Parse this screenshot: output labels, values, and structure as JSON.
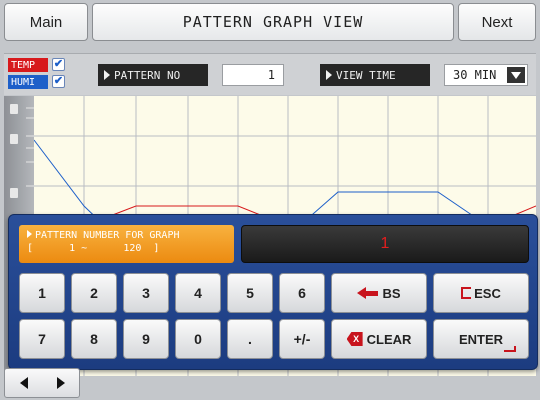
{
  "header": {
    "left_button": "Main",
    "title": "PATTERN GRAPH VIEW",
    "right_button": "Next"
  },
  "controls": {
    "temp_label": "TEMP",
    "humi_label": "HUMI",
    "temp_checked": true,
    "humi_checked": true,
    "pattern_no_label": "PATTERN NO",
    "pattern_no_value": "1",
    "view_time_label": "VIEW TIME",
    "view_time_value": "30 MIN"
  },
  "keypad": {
    "prompt_title": "PATTERN NUMBER FOR GRAPH",
    "prompt_range": "[      1 ~      120  ]",
    "display_value": "1",
    "row1": [
      "1",
      "2",
      "3",
      "4",
      "5",
      "6"
    ],
    "row2": [
      "7",
      "8",
      "9",
      "0",
      ".",
      "+/-"
    ],
    "bs_label": "BS",
    "esc_label": "ESC",
    "clear_label": "CLEAR",
    "clear_icon_glyph": "X",
    "enter_label": "ENTER"
  },
  "colors": {
    "temp_color": "#d7191c",
    "humi_color": "#1d5fc9",
    "keypad_bg": "#1f4189",
    "prompt_bg": "#f5a02a",
    "accent_red": "#c8141d"
  },
  "icons": {
    "check": "checkmark-icon",
    "dropdown": "dropdown-arrow-icon",
    "backspace": "left-arrow-icon",
    "escape": "escape-bracket-icon",
    "clear": "clear-x-icon",
    "enter": "enter-return-icon",
    "prev": "triangle-left-icon",
    "next": "triangle-right-icon"
  }
}
